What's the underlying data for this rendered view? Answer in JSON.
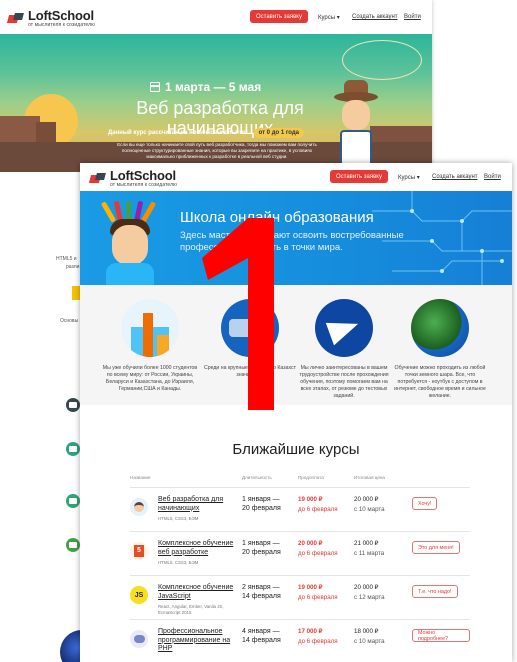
{
  "back": {
    "logo": {
      "name": "LoftSchool",
      "tagline": "от мыслителя к созидателю"
    },
    "nav": {
      "cta": "Оставить заявку",
      "courses": "Курсы",
      "create_account": "Создать аккаунт",
      "login": "Войти"
    },
    "hero": {
      "date": "1 марта — 5 мая",
      "title": "Веб разработка для начинающих",
      "offer": "Данный курс рассчитан на новичков с опытом",
      "offer_badge": "от 0 до 1 года",
      "desc": "Если вы еще только начинаете свой путь веб разработчика, тогда мы поможем вам получить полноценные структурированные знания, которые вы закрепите на практике, в условиях максимально приближенных к разработке в реальной веб студии."
    },
    "side_texts": [
      "HTML5 и",
      "разли",
      "Основы р"
    ]
  },
  "front": {
    "logo": {
      "name": "LoftSchool",
      "tagline": "от мыслителя к созидателю"
    },
    "nav": {
      "cta": "Оставить заявку",
      "courses": "Курсы",
      "create_account": "Создать аккаунт",
      "login": "Войти"
    },
    "hero": {
      "title": "Школа онлайн образования",
      "subtitle": "Здесь мастера помогают освоить востребованные профессию и работать в точки мира."
    },
    "features": [
      {
        "text": "Мы уже обучили более 1000 студентов по всему миру: от России, Украины, Беларуси и Казахстана, до Израиля, Германии,США и Канады."
      },
      {
        "text": "Среди на крупные IT ко центр Казахст значит наш"
      },
      {
        "text": "Мы лично заинтересованы в вашем трудоустройстве после прохождения обучения, поэтому помогаем вам на всех этапах, от резюме до тестовых заданий."
      },
      {
        "text": "Обучение можно проходить из любой точки земного шара. Все, что потребуется - ноутбук с доступом в интернет, свободное время и сильное желание."
      }
    ],
    "courses_title": "Ближайшие курсы",
    "table_head": {
      "name": "Название",
      "duration": "Длительность",
      "prepay": "Предоплата",
      "total": "Итоговая цена"
    },
    "courses": [
      {
        "name": "Веб разработка для начинающих",
        "tags": "HTML5, CSS3, БЭМ",
        "dur1": "1 января —",
        "dur2": "20 февраля",
        "price": "19 000 ₽",
        "until": "до 6 февраля",
        "full": "20 000 ₽",
        "full_until": "с 10 марта",
        "button": "Хочу!",
        "icon": ""
      },
      {
        "name": "Комплексное обучение веб разработке",
        "tags": "HTML5, CSS3, БЭМ",
        "dur1": "1 января —",
        "dur2": "20 февраля",
        "price": "20 000 ₽",
        "until": "до 6 февраля",
        "full": "21 000 ₽",
        "full_until": "с 11 марта",
        "button": "Это для меня!",
        "icon": "5"
      },
      {
        "name": "Комплексное обучение JavaScript",
        "tags": "React, Angular, Ember, Vanila JS, EcmaScript 2015",
        "dur1": "2 января —",
        "dur2": "14 февраля",
        "price": "19 000 ₽",
        "until": "до 6 февраля",
        "full": "20 000 ₽",
        "full_until": "с 12 марта",
        "button": "Т.е. что надо!",
        "icon": "JS"
      },
      {
        "name": "Профессиональное программирование на PHP",
        "tags": "",
        "dur1": "4 января —",
        "dur2": "14 февраля",
        "price": "17 000 ₽",
        "until": "до 6 февраля",
        "full": "18 000 ₽",
        "full_until": "с 10 марта",
        "button": "Можно подробнее?",
        "icon": ""
      }
    ]
  },
  "overlay_number": "1",
  "colors": {
    "accent": "#e53935",
    "hero_blue": "#1690de",
    "overlay_red": "#ff0000"
  }
}
